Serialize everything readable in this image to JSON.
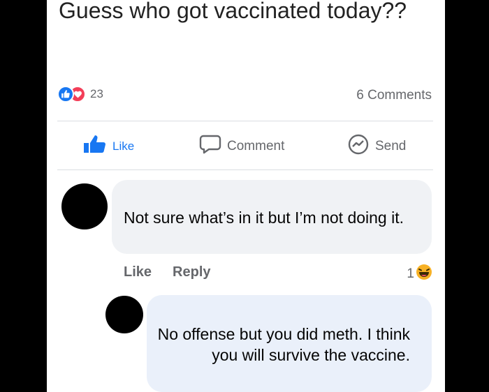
{
  "post": {
    "text": "Guess who got vaccinated today??",
    "reaction_count": "23",
    "comments_count": "6 Comments"
  },
  "actions": {
    "like": "Like",
    "comment": "Comment",
    "send": "Send"
  },
  "comments": [
    {
      "text": "Not sure what’s in it but I’m not doing it.",
      "like": "Like",
      "reply": "Reply",
      "reaction_count": "1"
    },
    {
      "text": "No offense but you did meth. I think you will survive the vaccine."
    }
  ],
  "colors": {
    "brand_blue": "#1877f2",
    "love_red": "#f33e58",
    "muted_text": "#65676b",
    "bubble_gray": "#f0f2f5",
    "bubble_blue": "#eaf0fa"
  },
  "icons": {
    "like_reaction": "thumbs-up-icon",
    "love_reaction": "heart-icon",
    "like_action": "thumbs-up-icon",
    "comment_action": "speech-bubble-icon",
    "send_action": "messenger-icon",
    "comment_reaction": "laughing-emoji-icon"
  }
}
